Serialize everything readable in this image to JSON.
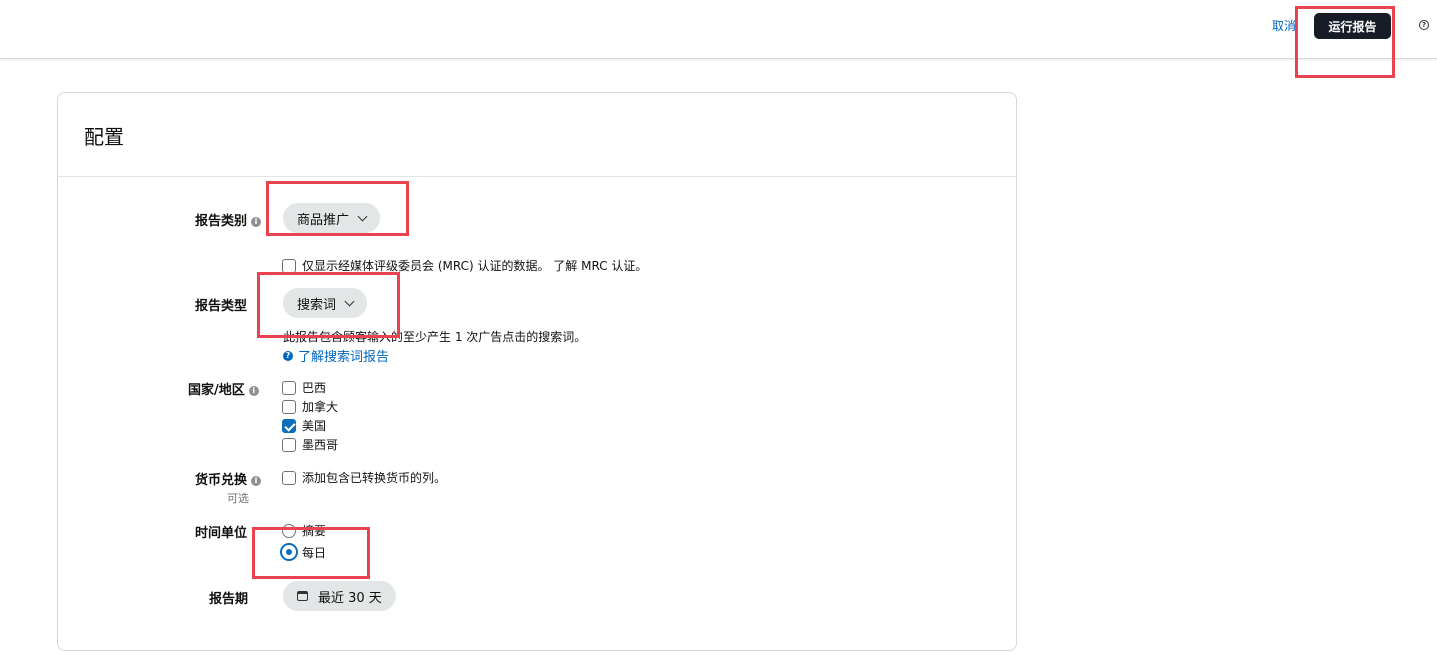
{
  "header": {
    "cancel_label": "取消",
    "run_report_label": "运行报告",
    "help_icon": "question-circle-icon"
  },
  "config": {
    "title": "配置",
    "report_category": {
      "label": "报告类别",
      "value": "商品推广"
    },
    "mrc": {
      "label": "仅显示经媒体评级委员会 (MRC) 认证的数据。 了解 MRC 认证。",
      "checked": false
    },
    "report_type": {
      "label": "报告类型",
      "value": "搜索词",
      "description": "此报告包含顾客输入的至少产生 1 次广告点击的搜索词。",
      "learn_link": "了解搜索词报告"
    },
    "country": {
      "label": "国家/地区",
      "options": [
        {
          "label": "巴西",
          "checked": false
        },
        {
          "label": "加拿大",
          "checked": false
        },
        {
          "label": "美国",
          "checked": true
        },
        {
          "label": "墨西哥",
          "checked": false
        }
      ]
    },
    "currency": {
      "label": "货币兑换",
      "optional": "可选",
      "option_label": "添加包含已转换货币的列。",
      "checked": false
    },
    "time_unit": {
      "label": "时间单位",
      "options": [
        {
          "label": "摘要",
          "selected": false
        },
        {
          "label": "每日",
          "selected": true
        }
      ]
    },
    "period": {
      "label": "报告期",
      "value": "最近 30 天"
    }
  },
  "colors": {
    "primary_button": "#161d26",
    "link": "#0066c0",
    "checked": "#0a6ebd",
    "highlight": "#e8434f"
  }
}
